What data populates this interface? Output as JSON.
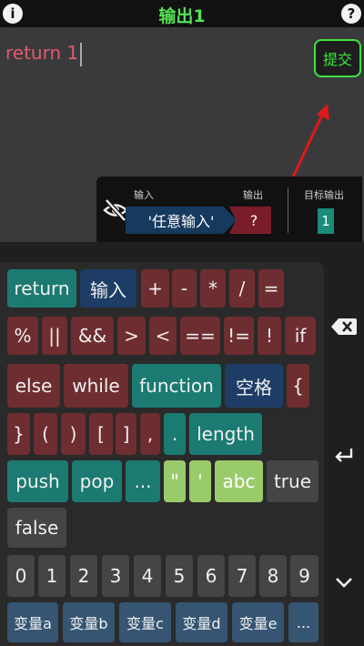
{
  "header": {
    "title": "输出1",
    "info_icon": "i",
    "help_icon": "?"
  },
  "editor": {
    "keyword": "return",
    "value": "1",
    "submit_label": "提交",
    "io": {
      "input_label": "输入",
      "output_label": "输出",
      "target_label": "目标输出",
      "input_value": "'任意输入'",
      "output_value": "?",
      "target_value": "1"
    }
  },
  "keyboard": {
    "row1": [
      "return",
      "输入",
      "+",
      "-",
      "*",
      "/",
      "="
    ],
    "row2": [
      "%",
      "||",
      "&&",
      ">",
      "<",
      "==",
      "!=",
      "!",
      "if"
    ],
    "row3": [
      "else",
      "while",
      "function",
      "空格",
      "{"
    ],
    "row4": [
      "}",
      "(",
      ")",
      "[",
      "]",
      ",",
      ".",
      "length"
    ],
    "row5": [
      "push",
      "pop",
      "...",
      "\"",
      "'",
      "abc",
      "true"
    ],
    "row6": [
      "false"
    ],
    "digits": [
      "0",
      "1",
      "2",
      "3",
      "4",
      "5",
      "6",
      "7",
      "8",
      "9"
    ],
    "vars": [
      "变量a",
      "变量b",
      "变量c",
      "变量d",
      "变量e",
      "..."
    ]
  },
  "side": {
    "backspace_icon": "backspace-icon",
    "enter_icon": "enter-icon",
    "collapse_icon": "chevron-down-icon"
  },
  "colors": {
    "accent_green": "#3fe33f",
    "teal": "#1b7a72",
    "blue": "#1d3d66",
    "red": "#6e2d30",
    "light_green": "#9acb6a",
    "arrow_red": "#e01818"
  }
}
